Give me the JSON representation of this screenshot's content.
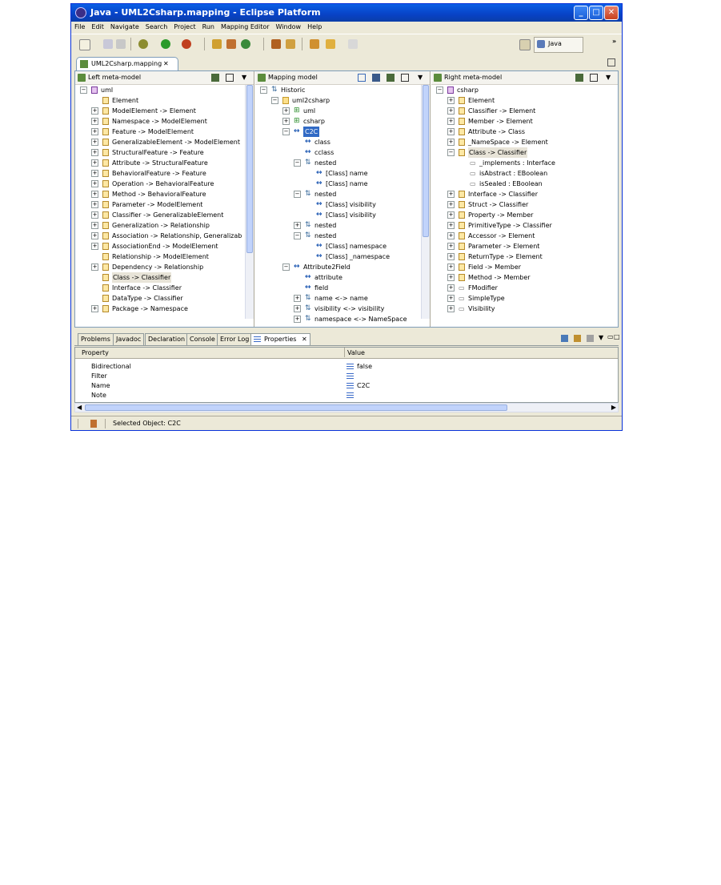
{
  "window": {
    "title": "Java - UML2Csharp.mapping - Eclipse Platform"
  },
  "menu": [
    "File",
    "Edit",
    "Navigate",
    "Search",
    "Project",
    "Run",
    "Mapping Editor",
    "Window",
    "Help"
  ],
  "perspective": {
    "label": "Java",
    "more": "»"
  },
  "editor_tab": {
    "label": "UML2Csharp.mapping",
    "close": "✕"
  },
  "left_pane": {
    "title": "Left meta-model",
    "rows": [
      {
        "t": "−",
        "i": "pk",
        "text": "uml",
        "d": 0
      },
      {
        "t": "",
        "i": "cl",
        "text": "Element",
        "d": 1
      },
      {
        "t": "+",
        "i": "cl",
        "text": "ModelElement -> Element",
        "d": 1
      },
      {
        "t": "+",
        "i": "cl",
        "text": "Namespace -> ModelElement",
        "d": 1
      },
      {
        "t": "+",
        "i": "cl",
        "text": "Feature -> ModelElement",
        "d": 1
      },
      {
        "t": "+",
        "i": "cl",
        "text": "GeneralizableElement -> ModelElement",
        "d": 1
      },
      {
        "t": "+",
        "i": "cl",
        "text": "StructuralFeature -> Feature",
        "d": 1
      },
      {
        "t": "+",
        "i": "cl",
        "text": "Attribute -> StructuralFeature",
        "d": 1
      },
      {
        "t": "+",
        "i": "cl",
        "text": "BehavioralFeature -> Feature",
        "d": 1
      },
      {
        "t": "+",
        "i": "cl",
        "text": "Operation -> BehavioralFeature",
        "d": 1
      },
      {
        "t": "+",
        "i": "cl",
        "text": "Method -> BehavioralFeature",
        "d": 1
      },
      {
        "t": "+",
        "i": "cl",
        "text": "Parameter -> ModelElement",
        "d": 1
      },
      {
        "t": "+",
        "i": "cl",
        "text": "Classifier -> GeneralizableElement",
        "d": 1
      },
      {
        "t": "+",
        "i": "cl",
        "text": "Generalization -> Relationship",
        "d": 1
      },
      {
        "t": "+",
        "i": "cl",
        "text": "Association -> Relationship, Generalizab",
        "d": 1
      },
      {
        "t": "+",
        "i": "cl",
        "text": "AssociationEnd -> ModelElement",
        "d": 1
      },
      {
        "t": "",
        "i": "cl",
        "text": "Relationship -> ModelElement",
        "d": 1
      },
      {
        "t": "+",
        "i": "cl",
        "text": "Dependency -> Relationship",
        "d": 1
      },
      {
        "t": "",
        "i": "cl",
        "text": "Class -> Classifier",
        "d": 1,
        "hl": true
      },
      {
        "t": "",
        "i": "cl",
        "text": "Interface -> Classifier",
        "d": 1
      },
      {
        "t": "",
        "i": "cl",
        "text": "DataType -> Classifier",
        "d": 1
      },
      {
        "t": "+",
        "i": "cl",
        "text": "Package -> Namespace",
        "d": 1
      }
    ]
  },
  "mapping_pane": {
    "title": "Mapping model",
    "rows": [
      {
        "t": "−",
        "i": "nt",
        "text": "Historic",
        "d": 0
      },
      {
        "t": "−",
        "i": "fd",
        "text": "uml2csharp",
        "d": 1
      },
      {
        "t": "+",
        "i": "mp",
        "text": "uml",
        "d": 2
      },
      {
        "t": "+",
        "i": "mp",
        "text": "csharp",
        "d": 2
      },
      {
        "t": "−",
        "i": "ar",
        "text": "C2C",
        "d": 2,
        "sel": true
      },
      {
        "t": "",
        "i": "ar",
        "text": "class",
        "d": 3
      },
      {
        "t": "",
        "i": "ar",
        "text": "cclass",
        "d": 3
      },
      {
        "t": "−",
        "i": "nt",
        "text": "nested",
        "d": 3
      },
      {
        "t": "",
        "i": "ar",
        "text": "[Class] name",
        "d": 4
      },
      {
        "t": "",
        "i": "ar",
        "text": "[Class] name",
        "d": 4
      },
      {
        "t": "−",
        "i": "nt",
        "text": "nested",
        "d": 3
      },
      {
        "t": "",
        "i": "ar",
        "text": "[Class] visibility",
        "d": 4
      },
      {
        "t": "",
        "i": "ar",
        "text": "[Class] visibility",
        "d": 4
      },
      {
        "t": "+",
        "i": "nt",
        "text": "nested",
        "d": 3
      },
      {
        "t": "−",
        "i": "nt",
        "text": "nested",
        "d": 3
      },
      {
        "t": "",
        "i": "ar",
        "text": "[Class] namespace",
        "d": 4
      },
      {
        "t": "",
        "i": "ar",
        "text": "[Class] _namespace",
        "d": 4
      },
      {
        "t": "−",
        "i": "ar",
        "text": "Attribute2Field",
        "d": 2
      },
      {
        "t": "",
        "i": "ar",
        "text": "attribute",
        "d": 3
      },
      {
        "t": "",
        "i": "ar",
        "text": "field",
        "d": 3
      },
      {
        "t": "+",
        "i": "nt",
        "text": "name <-> name",
        "d": 3
      },
      {
        "t": "+",
        "i": "nt",
        "text": "visibility <-> visibility",
        "d": 3
      },
      {
        "t": "+",
        "i": "nt",
        "text": "namespace <-> NameSpace",
        "d": 3
      }
    ]
  },
  "right_pane": {
    "title": "Right meta-model",
    "rows": [
      {
        "t": "−",
        "i": "pk",
        "text": "csharp",
        "d": 0
      },
      {
        "t": "+",
        "i": "cl",
        "text": "Element",
        "d": 1
      },
      {
        "t": "+",
        "i": "cl",
        "text": "Classifier -> Element",
        "d": 1
      },
      {
        "t": "+",
        "i": "cl",
        "text": "Member -> Element",
        "d": 1
      },
      {
        "t": "+",
        "i": "cl",
        "text": "Attribute -> Class",
        "d": 1
      },
      {
        "t": "+",
        "i": "cl",
        "text": "_NameSpace -> Element",
        "d": 1
      },
      {
        "t": "−",
        "i": "cl",
        "text": "Class -> Classifier",
        "d": 1,
        "hl": true
      },
      {
        "t": "",
        "i": "at",
        "text": "_implements : Interface",
        "d": 2
      },
      {
        "t": "",
        "i": "at",
        "text": "isAbstract : EBoolean",
        "d": 2
      },
      {
        "t": "",
        "i": "at",
        "text": "isSealed : EBoolean",
        "d": 2
      },
      {
        "t": "+",
        "i": "cl",
        "text": "Interface -> Classifier",
        "d": 1
      },
      {
        "t": "+",
        "i": "cl",
        "text": "Struct -> Classifier",
        "d": 1
      },
      {
        "t": "+",
        "i": "cl",
        "text": "Property -> Member",
        "d": 1
      },
      {
        "t": "+",
        "i": "cl",
        "text": "PrimitiveType -> Classifier",
        "d": 1
      },
      {
        "t": "+",
        "i": "cl",
        "text": "Accessor -> Element",
        "d": 1
      },
      {
        "t": "+",
        "i": "cl",
        "text": "Parameter -> Element",
        "d": 1
      },
      {
        "t": "+",
        "i": "cl",
        "text": "ReturnType -> Element",
        "d": 1
      },
      {
        "t": "+",
        "i": "cl",
        "text": "Field -> Member",
        "d": 1
      },
      {
        "t": "+",
        "i": "cl",
        "text": "Method -> Member",
        "d": 1
      },
      {
        "t": "+",
        "i": "at",
        "text": "FModifier",
        "d": 1
      },
      {
        "t": "+",
        "i": "at",
        "text": "SimpleType",
        "d": 1
      },
      {
        "t": "+",
        "i": "at",
        "text": "Visibility",
        "d": 1
      }
    ]
  },
  "bottom_tabs": [
    "Problems",
    "Javadoc",
    "Declaration",
    "Console",
    "Error Log",
    "Properties"
  ],
  "properties": {
    "col_property": "Property",
    "col_value": "Value",
    "rows": [
      {
        "name": "Bidirectional",
        "value": "false"
      },
      {
        "name": "Filter",
        "value": ""
      },
      {
        "name": "Name",
        "value": "C2C"
      },
      {
        "name": "Note",
        "value": ""
      }
    ]
  },
  "status": {
    "text": "Selected Object: C2C"
  }
}
